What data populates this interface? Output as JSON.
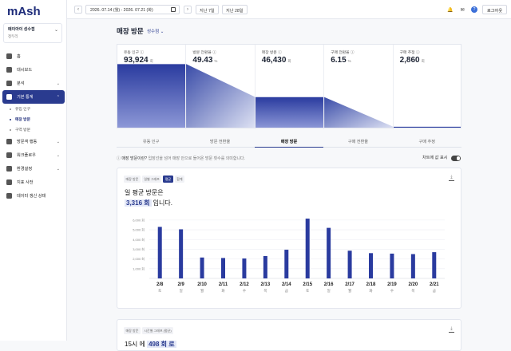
{
  "app": {
    "logo": "mAsh",
    "store_name": "메이아이 성수점",
    "store_owner": "정두리",
    "dropdown": "⌄"
  },
  "sidebar": {
    "items": [
      {
        "label": "홈",
        "icon": "home-icon"
      },
      {
        "label": "대시보드",
        "icon": "dashboard-icon"
      },
      {
        "label": "분석",
        "icon": "analysis-icon",
        "caret": "⌄"
      },
      {
        "label": "기본 통계",
        "icon": "stats-icon",
        "caret": "⌃"
      },
      {
        "label": "방문객 행동",
        "icon": "behavior-icon",
        "caret": "⌄"
      },
      {
        "label": "워크플로우",
        "icon": "workflow-icon",
        "caret": "⌄"
      },
      {
        "label": "환경설정",
        "icon": "settings-icon",
        "caret": "⌄"
      },
      {
        "label": "지표 사전",
        "icon": "dictionary-icon"
      },
      {
        "label": "데이터 갱신 상태",
        "icon": "refresh-icon"
      }
    ],
    "subitems": [
      {
        "label": "유입 인구"
      },
      {
        "label": "매장 방문"
      },
      {
        "label": "구역 방문"
      }
    ]
  },
  "topbar": {
    "prev": "‹",
    "next": "›",
    "date_range": "2026. 07.14 (월) - 2026. 07.21 (화)",
    "preset1": "지난 7일",
    "preset2": "지난 28일",
    "logout": "로그아웃",
    "bell": "🔔",
    "lang": "✉",
    "help": "?"
  },
  "page": {
    "title": "매장 방문",
    "store_selector": "성수점 ⌄"
  },
  "funnel": {
    "stages": [
      {
        "label": "유동 인구 ⓘ",
        "value": "93,924",
        "unit": "회"
      },
      {
        "label": "방문 전환율 ⓘ",
        "value": "49.43",
        "unit": "%"
      },
      {
        "label": "매장 방문 ⓘ",
        "value": "46,430",
        "unit": "회"
      },
      {
        "label": "구매 전환율 ⓘ",
        "value": "6.15",
        "unit": "%"
      },
      {
        "label": "구매 추정 ⓘ",
        "value": "2,860",
        "unit": "회"
      }
    ],
    "levels": [
      0.77,
      0.38,
      0.03
    ]
  },
  "tabs": [
    "유동 인구",
    "방문 전환율",
    "매장 방문",
    "구매 전환율",
    "구매 추정"
  ],
  "info": {
    "label": "매장 방문이란?",
    "text": "입장선을 넘어 매장 안으로 들어온 방문 횟수를 의미합니다."
  },
  "chart_toggle": "차트에 값 표시",
  "card1": {
    "chips": [
      "매장 방문",
      "일별 그래프",
      "평균",
      "합계"
    ],
    "line1": "일 평균 방문은",
    "highlight": "3,316 회",
    "line2": "입니다.",
    "download": "⤓"
  },
  "card2": {
    "chips": [
      "매장 방문",
      "시간별 그래프 (평균)"
    ],
    "line1_prefix": "15시 에",
    "highlight": "498 회 로",
    "download": "⤓"
  },
  "chart_data": {
    "type": "bar",
    "categories": [
      "2/8",
      "2/9",
      "2/10",
      "2/11",
      "2/12",
      "2/13",
      "2/14",
      "2/15",
      "2/16",
      "2/17",
      "2/18",
      "2/19",
      "2/20",
      "2/21"
    ],
    "weekdays": [
      "토",
      "일",
      "월",
      "화",
      "수",
      "목",
      "금",
      "토",
      "일",
      "월",
      "화",
      "수",
      "목",
      "금"
    ],
    "values": [
      5300,
      5050,
      2150,
      2100,
      2050,
      2300,
      2950,
      6150,
      5200,
      2850,
      2600,
      2550,
      2500,
      2700
    ],
    "yticks": [
      "1,000 회",
      "2,000 회",
      "3,000 회",
      "4,000 회",
      "5,000 회",
      "6,000 회"
    ],
    "ylim": [
      0,
      6400
    ],
    "color": "#2a3b9f",
    "grid": true
  }
}
